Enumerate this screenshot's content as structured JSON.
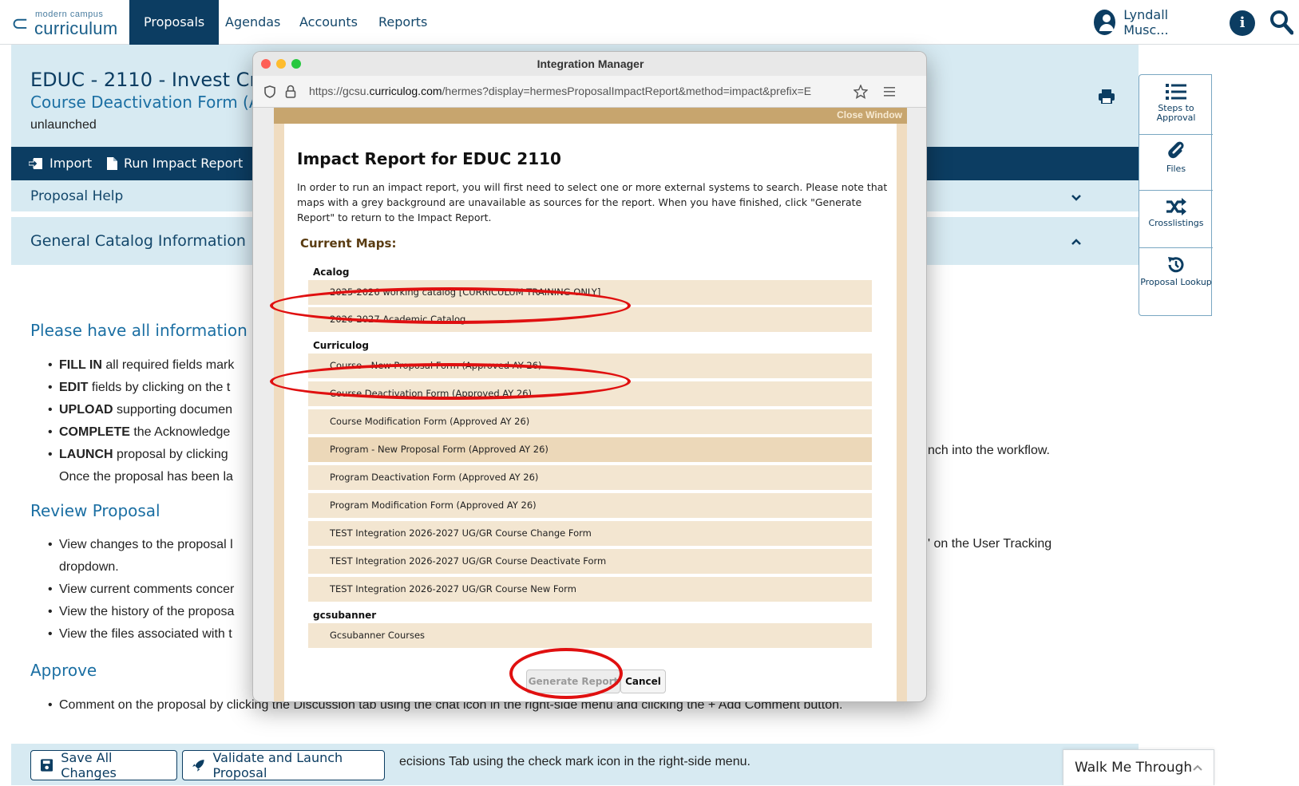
{
  "nav": {
    "logo_small": "modern campus",
    "logo_big": "curriculum",
    "tabs": [
      {
        "label": "Proposals"
      },
      {
        "label": "Agendas"
      },
      {
        "label": "Accounts"
      },
      {
        "label": "Reports"
      }
    ],
    "user": "Lyndall Musc...",
    "info_glyph": "i"
  },
  "proposal": {
    "course_title": "EDUC - 2110 - Invest Crit Co",
    "form_title": "Course Deactivation Form (Appr",
    "status": "unlaunched"
  },
  "toolbar": {
    "import_label": "Import",
    "impact_label": "Run Impact Report"
  },
  "sections": {
    "help": "Proposal Help",
    "catalog": "General Catalog Information",
    "please_have": "Please have all information for t",
    "review": "Review Proposal",
    "approve": "Approve"
  },
  "instructions": [
    {
      "bold": "FILL IN",
      "text": " all required fields mark"
    },
    {
      "bold": "EDIT",
      "text": " fields by clicking on the t"
    },
    {
      "bold": "UPLOAD",
      "text": " supporting documen"
    },
    {
      "bold": "COMPLETE",
      "text": " the Acknowledge"
    },
    {
      "bold": "LAUNCH",
      "text": " proposal by clicking"
    }
  ],
  "instructions_cont": "Once the proposal has been la",
  "instructions_tail": "nch into the workflow.",
  "review_items": [
    "View changes to the proposal l",
    "View current comments concer",
    "View the history of the proposa",
    "View the files associated with t"
  ],
  "review_cont": "dropdown.",
  "review_tail": "' on the User Tracking",
  "approve_item": "Comment on the proposal by clicking the Discussion tab using the chat icon in the right-side menu and clicking the + Add Comment button.",
  "approve_item2_tail": "ecisions Tab using the check mark icon in the right-side menu.",
  "footer": {
    "save_label": "Save All Changes",
    "launch_label": "Validate and Launch Proposal"
  },
  "side_menu": [
    {
      "icon": "list-icon",
      "label": "Steps to Approval"
    },
    {
      "icon": "paperclip-icon",
      "label": "Files"
    },
    {
      "icon": "shuffle-icon",
      "label": "Crosslistings"
    },
    {
      "icon": "history-icon",
      "label": "Proposal Lookup"
    }
  ],
  "walk_me": "Walk Me Through",
  "popup": {
    "window_title": "Integration Manager",
    "url_prefix": "https://gcsu.",
    "url_domain": "curriculog.com",
    "url_rest": "/hermes?display=hermesProposalImpactReport&method=impact&prefix=E",
    "close_window": "Close Window",
    "title": "Impact Report for EDUC 2110",
    "description": "In order to run an impact report, you will first need to select one or more external systems to search. Please note that maps with a grey background are unavailable as sources for the report. When you have finished, click \"Generate Report\" to return to the Impact Report.",
    "current_maps_label": "Current Maps:",
    "groups": [
      {
        "name": "Acalog",
        "maps": [
          "2025-2026 working catalog [CURRICULUM TRAINING ONLY]",
          "2026-2027 Academic Catalog"
        ]
      },
      {
        "name": "Curriculog",
        "maps": [
          "Course - New Proposal Form (Approved AY 26)",
          "Course Deactivation Form (Approved AY 26)",
          "Course Modification Form (Approved AY 26)",
          "Program - New Proposal Form (Approved AY 26)",
          "Program Deactivation Form (Approved AY 26)",
          "Program Modification Form (Approved AY 26)",
          "TEST Integration 2026-2027 UG/GR Course Change Form",
          "TEST Integration 2026-2027 UG/GR Course Deactivate Form",
          "TEST Integration 2026-2027 UG/GR Course New Form"
        ]
      },
      {
        "name": "gcsubanner",
        "maps": [
          "Gcsubanner Courses"
        ]
      }
    ],
    "generate_label": "Generate Report",
    "cancel_label": "Cancel"
  },
  "colors": {
    "brand_dark": "#0c3d62",
    "brand_light": "#d7eaf2",
    "annotation_red": "#e01010",
    "map_row_bg": "#f3e6d1"
  }
}
